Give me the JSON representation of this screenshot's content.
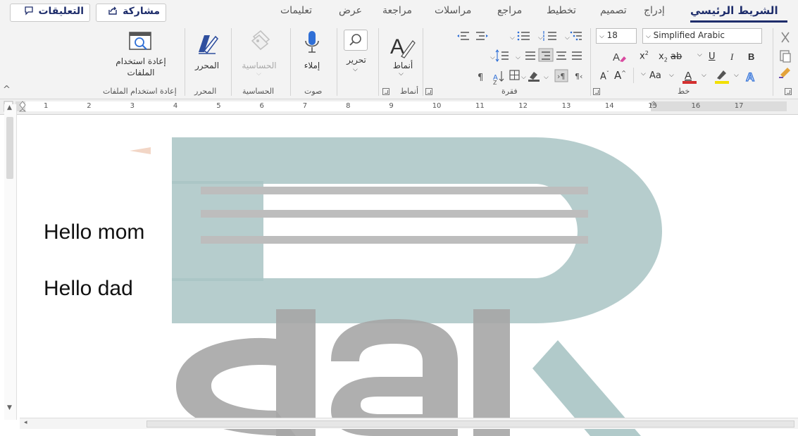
{
  "tabs": {
    "home": "الشريط الرئيسي",
    "insert": "إدراج",
    "design": "تصميم",
    "layout": "تخطيط",
    "references": "مراجع",
    "mailings": "مراسلات",
    "review": "مراجعة",
    "view": "عرض",
    "help": "تعليمات"
  },
  "header_buttons": {
    "share": "مشاركة",
    "comments": "التعليقات"
  },
  "ribbon": {
    "font": {
      "size": "18",
      "name": "Simplified Arabic",
      "group_label": "خط"
    },
    "paragraph": {
      "group_label": "فقرة"
    },
    "styles": {
      "button_label": "أنماط",
      "group_label": "أنماط"
    },
    "editing": {
      "button_label": "تحرير"
    },
    "voice": {
      "button_label": "إملاء",
      "group_label": "صوت"
    },
    "sensitivity": {
      "button_label": "الحساسية",
      "group_label": "الحساسية"
    },
    "editor": {
      "button_label": "المحرر",
      "group_label": "المحرر"
    },
    "reuse_files": {
      "button_label_line1": "إعادة استخدام",
      "button_label_line2": "الملفات",
      "group_label": "إعادة استخدام الملفات"
    }
  },
  "ruler": {
    "numbers": [
      "1",
      "2",
      "3",
      "4",
      "5",
      "6",
      "7",
      "8",
      "9",
      "10",
      "11",
      "12",
      "13",
      "14",
      "15",
      "16",
      "17"
    ]
  },
  "document": {
    "lines": [
      "Hello mom",
      "Hello dad"
    ]
  },
  "colors": {
    "accent": "#1e2d6b",
    "font_color_bar": "#d32f2f",
    "highlight_bar": "#f2e000",
    "watermark_teal": "#a9c4c4",
    "watermark_gray": "#bdbdbd"
  }
}
